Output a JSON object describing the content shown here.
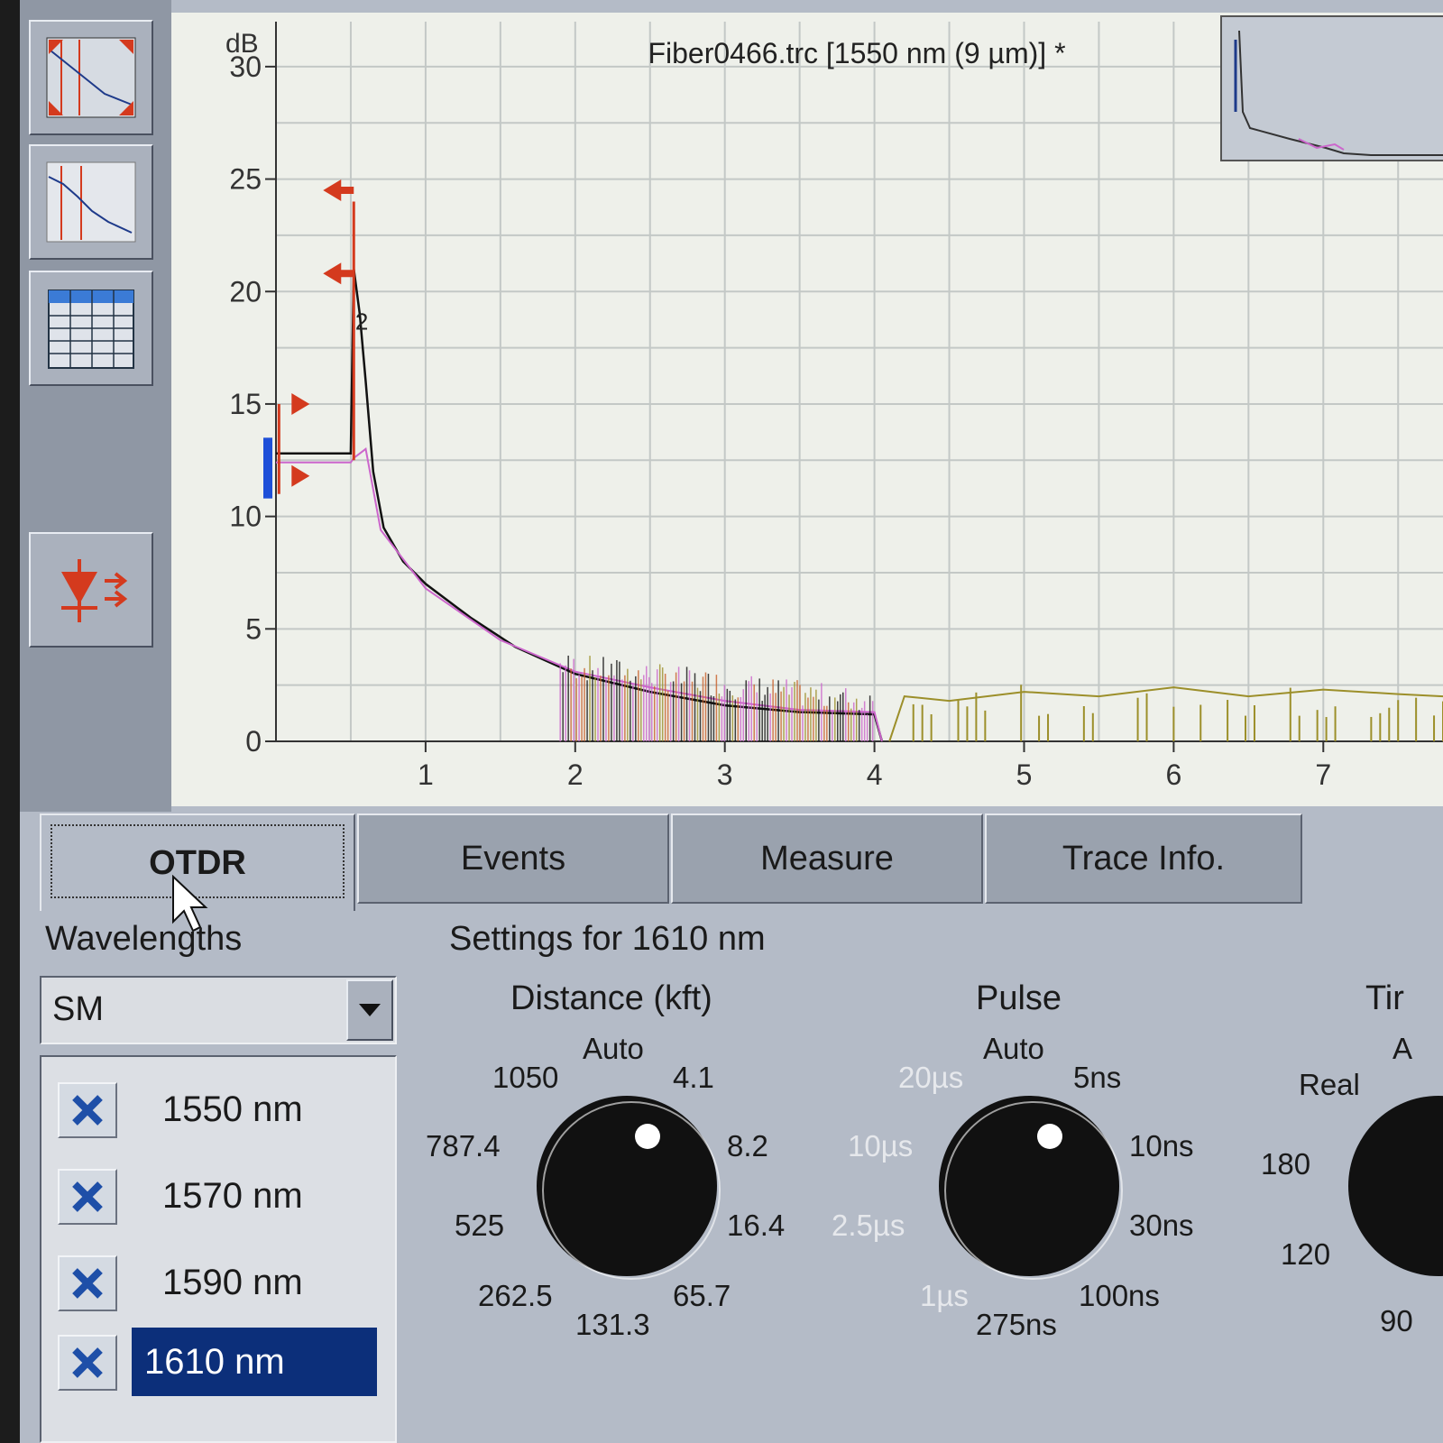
{
  "toolbar": {
    "buttons": [
      {
        "name": "zoom-full-icon"
      },
      {
        "name": "zoom-trace-icon"
      },
      {
        "name": "event-table-icon"
      },
      {
        "name": "laser-source-icon"
      }
    ]
  },
  "chart": {
    "title": "Fiber0466.trc [1550 nm (9 µm)] *",
    "y_unit": "dB",
    "colors": {
      "trace": "#111111",
      "pink": "#cc66cc",
      "olive": "#9c8f2a",
      "orange": "#c8602a",
      "marker": "#d43a1e",
      "blue_marker": "#1e4fd8",
      "grid": "#c3c8c6"
    }
  },
  "chart_data": {
    "type": "line",
    "title": "Fiber0466.trc [1550 nm (9 µm)] *",
    "ylabel": "dB",
    "xlabel": "",
    "xlim": [
      0,
      7.8
    ],
    "ylim": [
      0,
      32
    ],
    "x_ticks": [
      1,
      2,
      3,
      4,
      5,
      6,
      7
    ],
    "y_ticks": [
      0,
      5,
      10,
      15,
      20,
      25,
      30
    ],
    "grid": true,
    "event_label": "2",
    "series": [
      {
        "points": [
          [
            0,
            12.8
          ],
          [
            0.5,
            12.8
          ],
          [
            0.52,
            21
          ],
          [
            0.56,
            19
          ],
          [
            0.6,
            16
          ],
          [
            0.65,
            12
          ],
          [
            0.72,
            9.5
          ],
          [
            0.85,
            8
          ],
          [
            1.0,
            7
          ],
          [
            1.3,
            5.5
          ],
          [
            1.6,
            4.2
          ],
          [
            2.0,
            3.0
          ],
          [
            2.5,
            2.2
          ],
          [
            3.0,
            1.6
          ],
          [
            3.5,
            1.3
          ],
          [
            4.0,
            1.2
          ],
          [
            4.05,
            0
          ]
        ]
      },
      {
        "points": [
          [
            0,
            12.4
          ],
          [
            0.5,
            12.4
          ],
          [
            0.52,
            12.6
          ],
          [
            0.6,
            13
          ],
          [
            0.7,
            9.4
          ],
          [
            1.0,
            6.8
          ],
          [
            1.5,
            4.5
          ],
          [
            2.0,
            3.1
          ],
          [
            2.5,
            2.4
          ],
          [
            3.0,
            1.8
          ],
          [
            3.5,
            1.4
          ],
          [
            4.0,
            1.3
          ],
          [
            4.05,
            0
          ]
        ]
      },
      {
        "points": [
          [
            4.1,
            0
          ],
          [
            4.2,
            2.0
          ],
          [
            4.5,
            1.8
          ],
          [
            5.0,
            2.2
          ],
          [
            5.5,
            2.0
          ],
          [
            6.0,
            2.4
          ],
          [
            6.5,
            2.0
          ],
          [
            7.0,
            2.3
          ],
          [
            7.5,
            2.1
          ],
          [
            7.8,
            2.0
          ]
        ]
      }
    ]
  },
  "tabs": [
    {
      "label": "OTDR"
    },
    {
      "label": "Events"
    },
    {
      "label": "Measure"
    },
    {
      "label": "Trace Info."
    }
  ],
  "wavelengths": {
    "heading": "Wavelengths",
    "mode": "SM",
    "items": [
      {
        "label": "1550 nm",
        "checked": true
      },
      {
        "label": "1570 nm",
        "checked": true
      },
      {
        "label": "1590 nm",
        "checked": true
      },
      {
        "label": "1610 nm",
        "checked": true,
        "selected": true
      }
    ]
  },
  "settings": {
    "heading": "Settings for 1610 nm",
    "distance": {
      "title": "Distance (kft)",
      "options": [
        "Auto",
        "4.1",
        "8.2",
        "16.4",
        "65.7",
        "131.3",
        "262.5",
        "525",
        "787.4",
        "1050"
      ]
    },
    "pulse": {
      "title": "Pulse",
      "options": [
        "Auto",
        "5ns",
        "10ns",
        "30ns",
        "100ns",
        "275ns",
        "1µs",
        "2.5µs",
        "10µs",
        "20µs"
      ]
    },
    "time": {
      "title": "Tir",
      "options": [
        "A",
        "Real",
        "180",
        "120",
        "90"
      ]
    }
  }
}
